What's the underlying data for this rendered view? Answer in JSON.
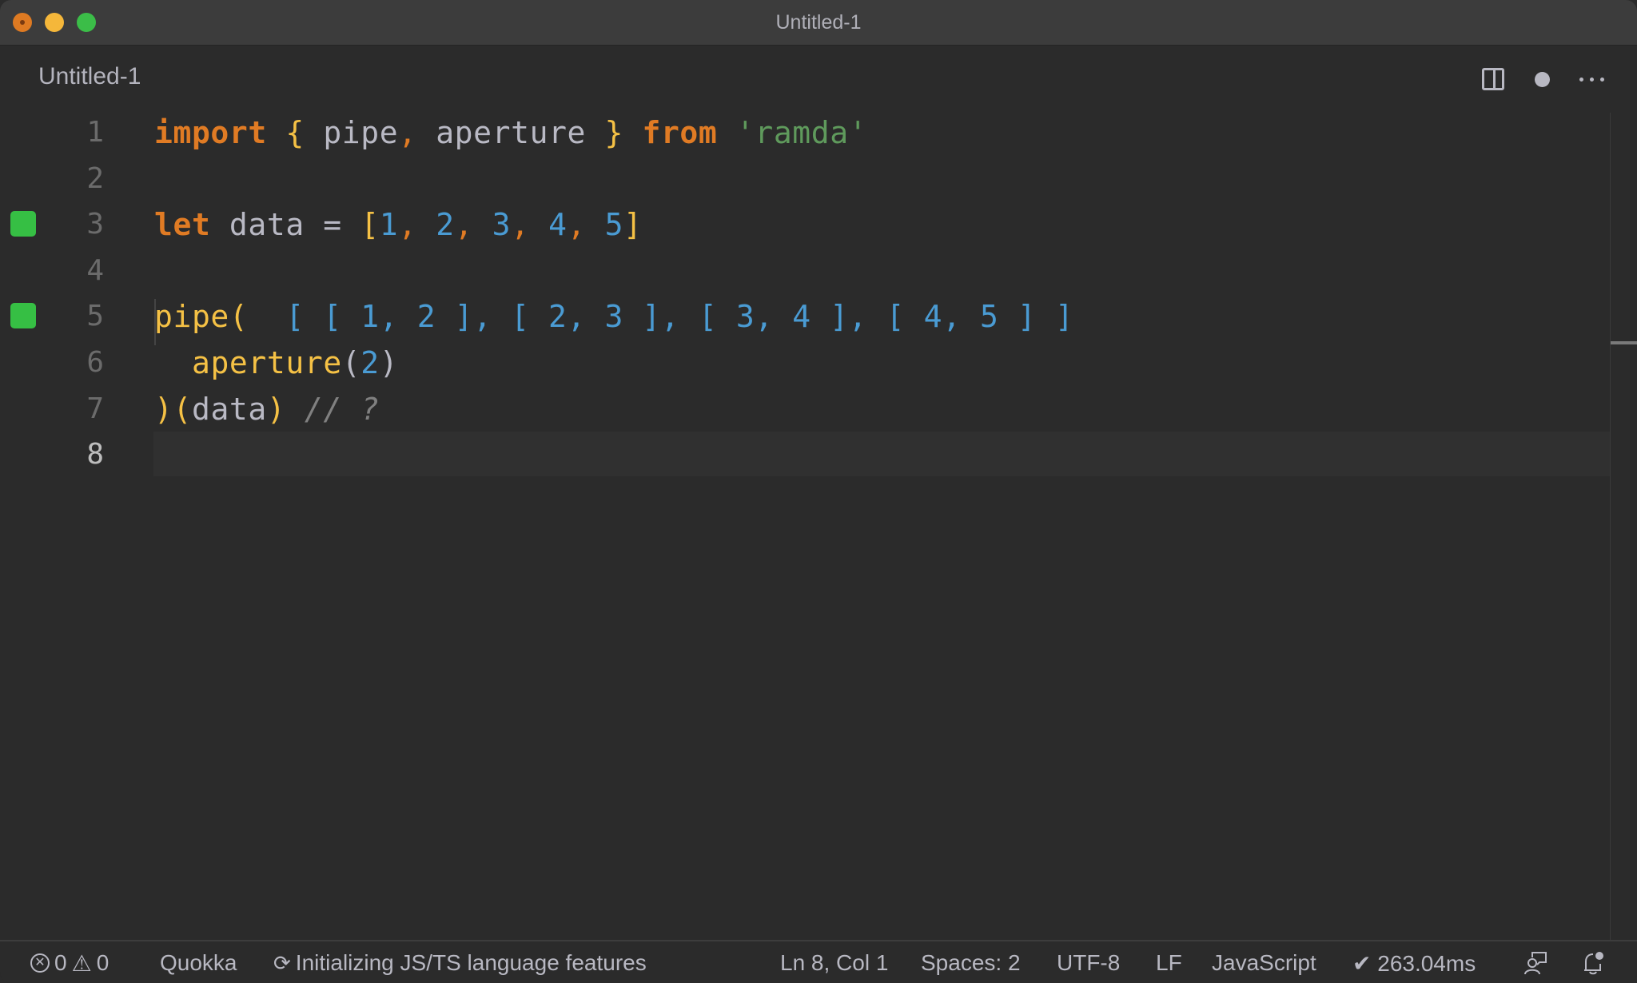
{
  "window": {
    "title": "Untitled-1"
  },
  "tab": {
    "label": "Untitled-1",
    "dirty": true
  },
  "tab_actions": [
    {
      "name": "split-editor",
      "icon": "split-editor-icon"
    },
    {
      "name": "unsaved-indicator",
      "icon": "dot-icon"
    },
    {
      "name": "more-actions",
      "icon": "ellipsis-icon"
    }
  ],
  "editor": {
    "language": "JavaScript",
    "current_line": 8,
    "lines": [
      {
        "n": "1",
        "marker": false,
        "tokens": [
          {
            "t": "import",
            "c": "kw"
          },
          {
            "t": " ",
            "c": "id"
          },
          {
            "t": "{",
            "c": "brace"
          },
          {
            "t": " pipe",
            "c": "id"
          },
          {
            "t": ",",
            "c": "punc"
          },
          {
            "t": " aperture ",
            "c": "id"
          },
          {
            "t": "}",
            "c": "brace"
          },
          {
            "t": " ",
            "c": "id"
          },
          {
            "t": "from",
            "c": "kw"
          },
          {
            "t": " ",
            "c": "id"
          },
          {
            "t": "'ramda'",
            "c": "str"
          }
        ]
      },
      {
        "n": "2",
        "marker": false,
        "tokens": []
      },
      {
        "n": "3",
        "marker": true,
        "tokens": [
          {
            "t": "let",
            "c": "kw"
          },
          {
            "t": " data = ",
            "c": "id"
          },
          {
            "t": "[",
            "c": "brace"
          },
          {
            "t": "1",
            "c": "num"
          },
          {
            "t": ", ",
            "c": "punc"
          },
          {
            "t": "2",
            "c": "num"
          },
          {
            "t": ", ",
            "c": "punc"
          },
          {
            "t": "3",
            "c": "num"
          },
          {
            "t": ", ",
            "c": "punc"
          },
          {
            "t": "4",
            "c": "num"
          },
          {
            "t": ", ",
            "c": "punc"
          },
          {
            "t": "5",
            "c": "num"
          },
          {
            "t": "]",
            "c": "brace"
          }
        ]
      },
      {
        "n": "4",
        "marker": false,
        "tokens": []
      },
      {
        "n": "5",
        "marker": true,
        "tokens": [
          {
            "t": "pipe(",
            "c": "fn"
          },
          {
            "t": "  [ [ 1, 2 ], [ 2, 3 ], [ 3, 4 ], [ 4, 5 ] ]",
            "c": "result"
          }
        ]
      },
      {
        "n": "6",
        "marker": false,
        "tokens": [
          {
            "t": "  ",
            "c": "id"
          },
          {
            "t": "aperture",
            "c": "fn"
          },
          {
            "t": "(",
            "c": "id"
          },
          {
            "t": "2",
            "c": "num"
          },
          {
            "t": ")",
            "c": "id"
          }
        ]
      },
      {
        "n": "7",
        "marker": false,
        "tokens": [
          {
            "t": ")(",
            "c": "fn"
          },
          {
            "t": "data",
            "c": "id"
          },
          {
            "t": ")",
            "c": "fn"
          },
          {
            "t": " ",
            "c": "id"
          },
          {
            "t": "// ?",
            "c": "cmt"
          }
        ]
      },
      {
        "n": "8",
        "marker": false,
        "tokens": []
      }
    ]
  },
  "statusbar": {
    "errors": "0",
    "warnings": "0",
    "quokka": "Quokka",
    "language_status": "Initializing JS/TS language features",
    "cursor": "Ln 8, Col 1",
    "indent": "Spaces: 2",
    "encoding": "UTF-8",
    "eol": "LF",
    "language": "JavaScript",
    "timing": "✔ 263.04ms"
  },
  "colors": {
    "marker_green": "#36bf44",
    "keyword": "#e07b24",
    "function": "#f5c145",
    "number": "#4a9bd3",
    "string": "#5f9a5c",
    "comment": "#808080"
  }
}
